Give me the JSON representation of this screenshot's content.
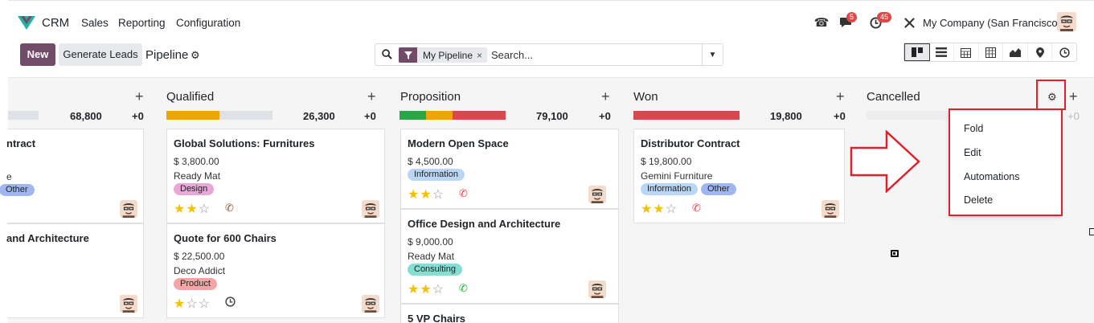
{
  "navbar": {
    "app_name": "CRM",
    "menu": [
      "Sales",
      "Reporting",
      "Configuration"
    ],
    "messages_count": "5",
    "activities_count": "45",
    "company": "My Company (San Francisco)"
  },
  "control_panel": {
    "new_label": "New",
    "generate_label": "Generate Leads",
    "title": "Pipeline",
    "search": {
      "facet": "My Pipeline",
      "facet_remove": "×",
      "placeholder": "Search..."
    },
    "views": [
      "kanban",
      "list",
      "calendar",
      "pivot",
      "graph",
      "map",
      "activity"
    ]
  },
  "colors": {
    "brand": "#714b67",
    "won_bar": "#d9474f",
    "ok_bar": "#28a745",
    "warn_bar": "#f0a30a",
    "annotation": "#e0202a"
  },
  "columns": [
    {
      "key": "new",
      "title": "",
      "sum": "68,800",
      "plus0": "+0",
      "cards": [
        {
          "title": "ntract",
          "line1": "",
          "line2": "e",
          "tags": [
            "Other"
          ]
        },
        {
          "title": "and Architecture"
        }
      ]
    },
    {
      "key": "qualified",
      "title": "Qualified",
      "sum": "26,300",
      "plus0": "+0",
      "cards": [
        {
          "title": "Global Solutions: Furnitures",
          "amount": "$ 3,800.00",
          "partner": "Ready Mat",
          "tags": [
            "Design"
          ],
          "stars": 2
        },
        {
          "title": "Quote for 600 Chairs",
          "amount": "$ 22,500.00",
          "partner": "Deco Addict",
          "tags": [
            "Product"
          ],
          "stars": 1
        }
      ]
    },
    {
      "key": "proposition",
      "title": "Proposition",
      "sum": "79,100",
      "plus0": "+0",
      "cards": [
        {
          "title": "Modern Open Space",
          "amount": "$ 4,500.00",
          "tags": [
            "Information"
          ],
          "stars": 2
        },
        {
          "title": "Office Design and Architecture",
          "amount": "$ 9,000.00",
          "partner": "Ready Mat",
          "tags": [
            "Consulting"
          ],
          "stars": 2
        },
        {
          "title": "5 VP Chairs"
        }
      ]
    },
    {
      "key": "won",
      "title": "Won",
      "sum": "19,800",
      "plus0": "+0",
      "cards": [
        {
          "title": "Distributor Contract",
          "amount": "$ 19,800.00",
          "partner": "Gemini Furniture",
          "tags": [
            "Information",
            "Other"
          ],
          "stars": 2
        }
      ]
    },
    {
      "key": "cancelled",
      "title": "Cancelled",
      "plus0": "+0"
    }
  ],
  "column_menu": {
    "items": [
      "Fold",
      "Edit",
      "Automations",
      "Delete"
    ]
  }
}
